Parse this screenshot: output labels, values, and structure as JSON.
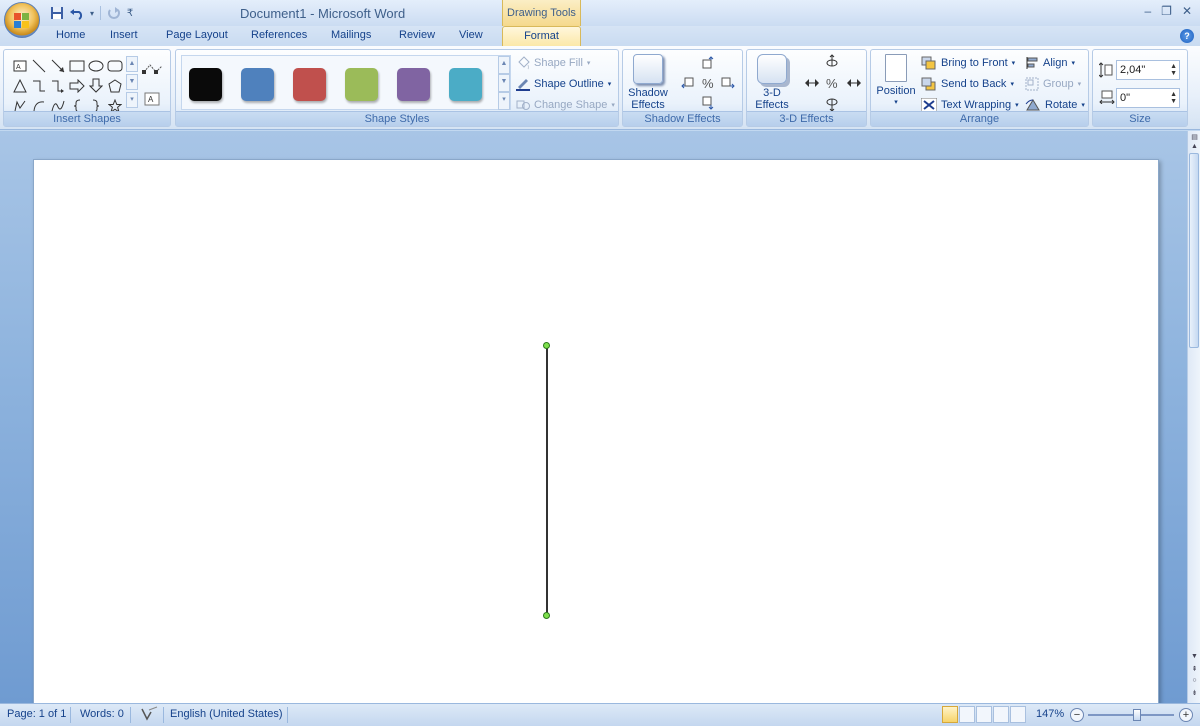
{
  "title_bar": {
    "document_title": "Document1 - Microsoft Word",
    "context_tab_title": "Drawing Tools",
    "window_controls": [
      "–",
      "❐",
      "✕"
    ]
  },
  "tabs": [
    {
      "label": "Home"
    },
    {
      "label": "Insert"
    },
    {
      "label": "Page Layout"
    },
    {
      "label": "References"
    },
    {
      "label": "Mailings"
    },
    {
      "label": "Review"
    },
    {
      "label": "View"
    },
    {
      "label": "Format",
      "active": true
    }
  ],
  "ribbon": {
    "insert_shapes": {
      "label": "Insert Shapes",
      "shapes": [
        "text-box",
        "line",
        "arrow-line",
        "rectangle",
        "oval",
        "rounded-rectangle",
        "triangle",
        "elbow-connector",
        "elbow-arrow",
        "block-arrow-right",
        "block-arrow-down",
        "pentagon",
        "freeform",
        "arc",
        "curve",
        "brace-left",
        "brace-right",
        "star"
      ]
    },
    "shape_styles": {
      "label": "Shape Styles",
      "swatches": [
        "#0a0a0a",
        "#4f81bd",
        "#c0504d",
        "#9bbb59",
        "#8064a2",
        "#4bacc6"
      ],
      "shape_fill": "Shape Fill",
      "shape_outline": "Shape Outline",
      "change_shape": "Change Shape"
    },
    "shadow_effects": {
      "label": "Shadow Effects",
      "button_line1": "Shadow",
      "button_line2": "Effects"
    },
    "three_d_effects": {
      "label": "3-D Effects",
      "button_line1": "3-D",
      "button_line2": "Effects"
    },
    "arrange": {
      "label": "Arrange",
      "position": "Position",
      "bring_to_front": "Bring to Front",
      "send_to_back": "Send to Back",
      "text_wrapping": "Text Wrapping",
      "align": "Align",
      "group": "Group",
      "rotate": "Rotate"
    },
    "size": {
      "label": "Size",
      "height": "2,04\"",
      "width": "0\""
    }
  },
  "status_bar": {
    "page": "Page: 1 of 1",
    "words": "Words: 0",
    "language": "English (United States)",
    "zoom": "147%"
  }
}
